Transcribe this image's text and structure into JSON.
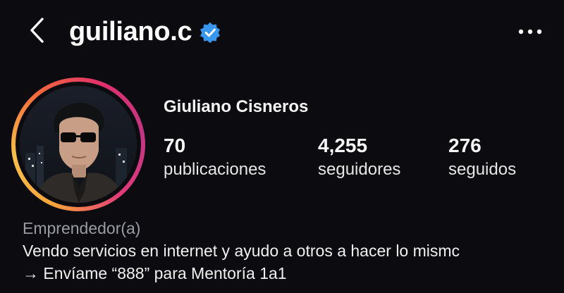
{
  "header": {
    "username": "guiliano.c",
    "verified_icon": "verified-badge-icon",
    "back_icon": "chevron-left-icon",
    "more_icon": "more-dots-icon"
  },
  "profile": {
    "full_name": "Giuliano Cisneros",
    "stats": {
      "posts": {
        "value": "70",
        "label": "publicaciones"
      },
      "followers": {
        "value": "4,255",
        "label": "seguidores"
      },
      "following": {
        "value": "276",
        "label": "seguidos"
      }
    },
    "bio": {
      "category": "Emprendedor(a)",
      "line1": "Vendo servicios en internet y ayudo a otros a hacer lo mismc",
      "line2": "→ Envíame “888” para Mentoría 1a1"
    }
  },
  "colors": {
    "background": "#0b0b10",
    "verified": "#3897f0",
    "ring_start": "#f9a13b",
    "ring_end": "#c13584"
  }
}
